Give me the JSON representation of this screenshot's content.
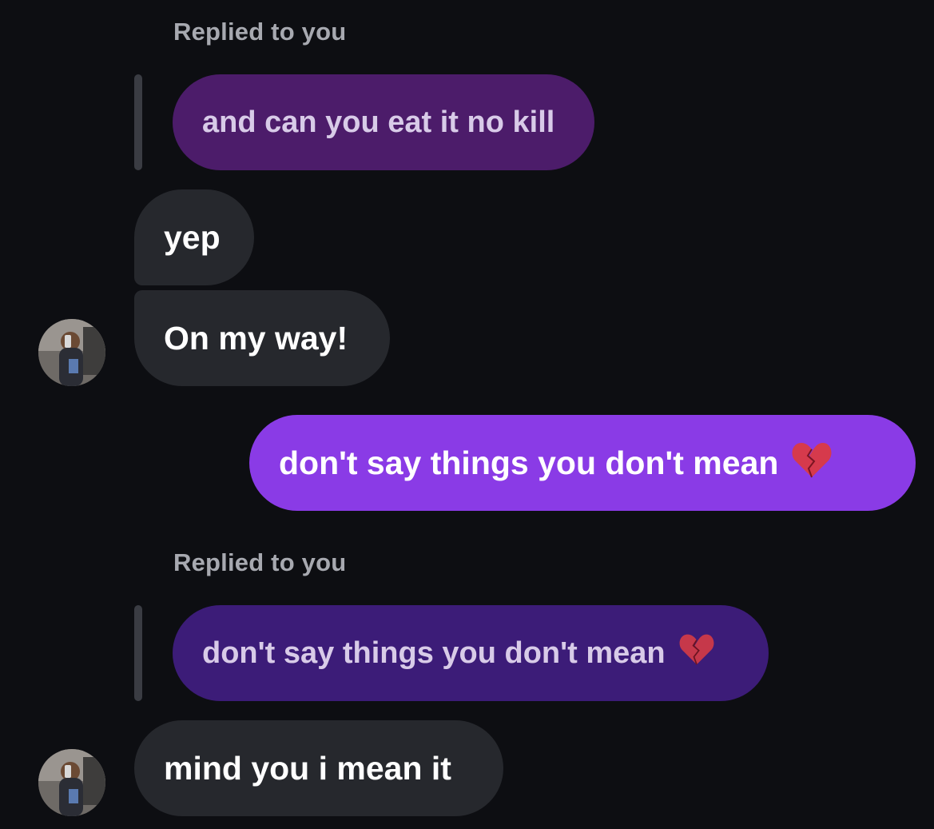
{
  "conversation": {
    "reply_label_1": "Replied to you",
    "quoted_msg_1": "and can you eat it no kill",
    "msg_yep": "yep",
    "msg_on_my_way": "On my way!",
    "msg_outgoing": "don't say things you don't mean",
    "reply_label_2": "Replied to you",
    "quoted_msg_2": "don't say things you don't mean",
    "msg_mind_you": "mind you i mean it"
  },
  "colors": {
    "background": "#0d0e12",
    "incoming_bubble": "#26282d",
    "outgoing_bubble": "#8a3be6",
    "quoted_bubble_1": "#4c1c6a",
    "quoted_bubble_2": "#3c1c78",
    "reply_label": "#a7a9b0"
  },
  "icons": {
    "heart": "broken-heart-icon",
    "avatar": "avatar"
  }
}
